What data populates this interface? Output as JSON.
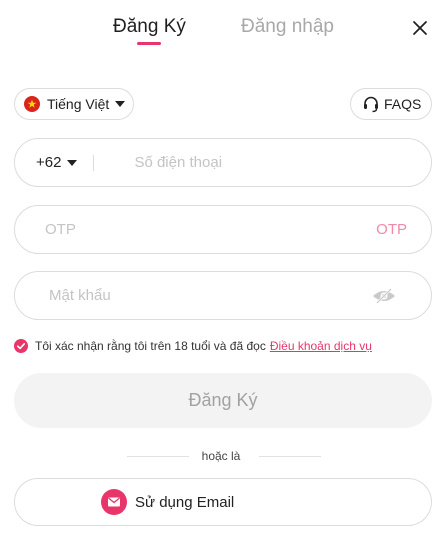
{
  "tabs": {
    "register": "Đăng Ký",
    "login": "Đăng nhập"
  },
  "language": {
    "label": "Tiếng Việt",
    "flag": "vietnam-flag-icon"
  },
  "faqs": {
    "label": "FAQS",
    "icon": "headset-icon"
  },
  "phone": {
    "country_code": "+62",
    "placeholder": "Số điện thoại"
  },
  "otp": {
    "placeholder": "OTP",
    "link_label": "OTP"
  },
  "password": {
    "placeholder": "Mật khẩu",
    "toggle_icon": "eye-hidden-icon"
  },
  "agreement": {
    "checked": true,
    "text": "Tôi xác nhận rằng tôi trên 18 tuổi và đã đọc",
    "link": "Điều khoản dịch vụ"
  },
  "submit": {
    "label": "Đăng Ký"
  },
  "separator": {
    "text": "hoặc là"
  },
  "email_option": {
    "label": "Sử dụng Email",
    "icon": "mail-icon"
  },
  "colors": {
    "accent": "#e8366b",
    "otp_link": "#f08aa6",
    "inactive_tab": "#a8a8a8",
    "disabled_button_bg": "#f3f3f3",
    "disabled_button_text": "#a2a2a2",
    "border": "#dcdcdc",
    "flag_red": "#da251d",
    "flag_star": "#ffde00"
  }
}
